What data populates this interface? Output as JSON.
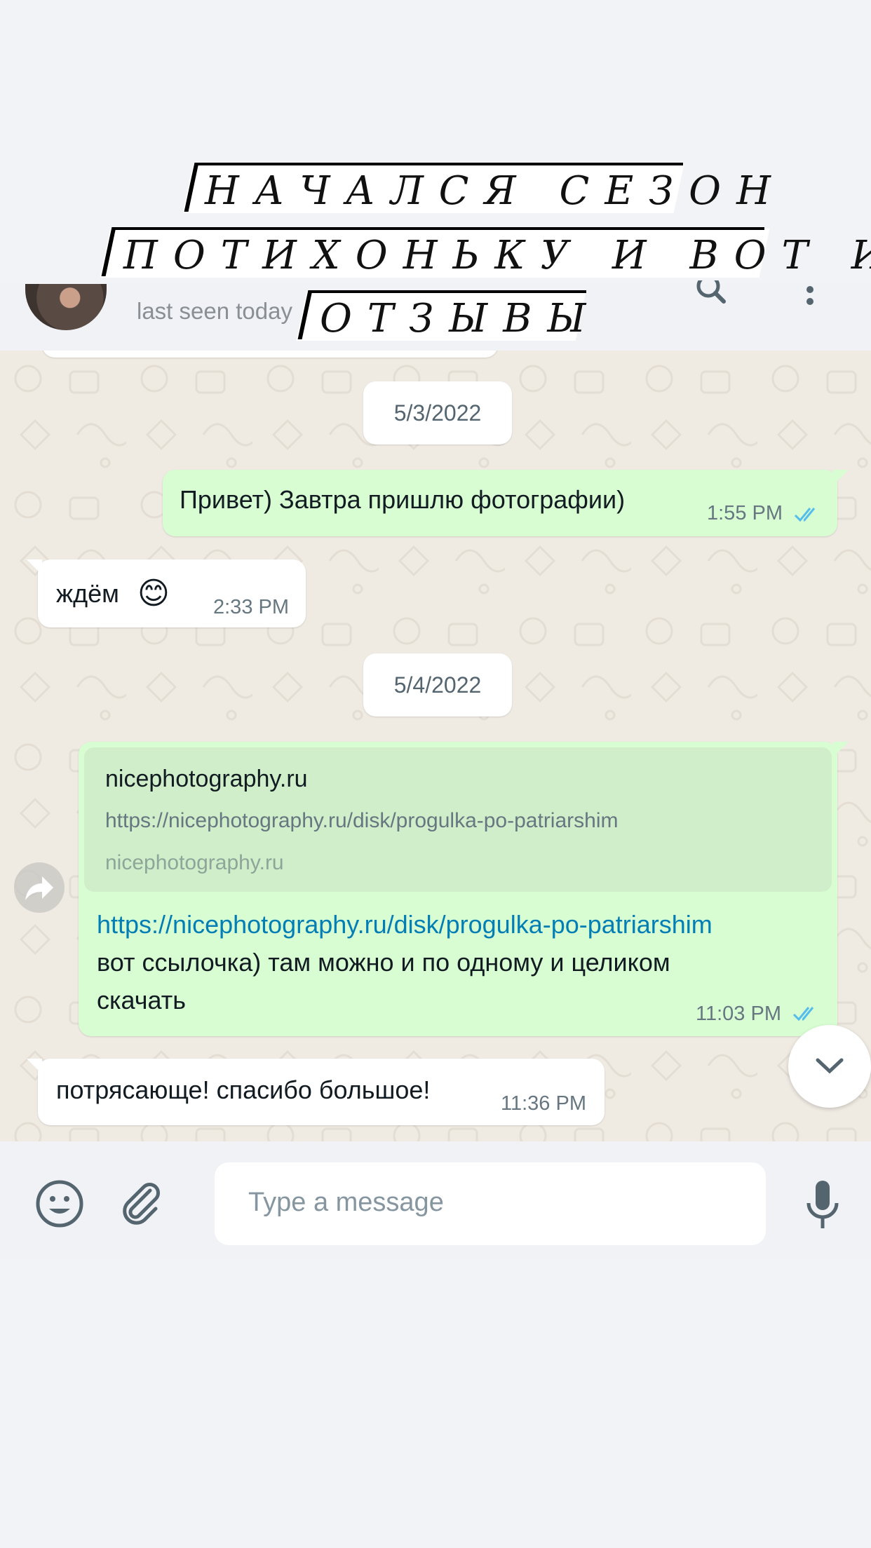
{
  "overlay": {
    "lines": [
      "НАЧАЛСЯ СЕЗОН",
      "ПОТИХОНЬКУ И ВОТ И",
      "ОТЗЫВЫ"
    ]
  },
  "header": {
    "last_seen": "last seen today",
    "icons": [
      "search-icon",
      "menu-icon"
    ]
  },
  "chat": {
    "dates": [
      "5/3/2022",
      "5/4/2022"
    ],
    "messages": [
      {
        "direction": "out",
        "text": "Привет) Завтра пришлю фотографии)",
        "time": "1:55 PM",
        "status": "read"
      },
      {
        "direction": "in",
        "text": "ждём",
        "emoji": "😊",
        "time": "2:33 PM"
      },
      {
        "direction": "out",
        "preview": {
          "title": "nicephotography.ru",
          "url": "https://nicephotography.ru/disk/progulka-po-patriarshim",
          "domain": "nicephotography.ru"
        },
        "link": "https://nicephotography.ru/disk/progulka-po-patriarshim",
        "line1": "вот ссылочка) там можно и по одному и целиком",
        "line2": "скачать",
        "time": "11:03 PM",
        "status": "read"
      },
      {
        "direction": "in",
        "text": "потрясающе! спасибо большое!",
        "time": "11:36 PM"
      }
    ]
  },
  "footer": {
    "placeholder": "Type a message",
    "icons": [
      "emoji-icon",
      "attach-icon",
      "microphone-icon"
    ]
  },
  "colors": {
    "outgoing": "#d9fdd3",
    "incoming": "#ffffff",
    "read_ticks": "#53bdeb",
    "link": "#027eb5"
  }
}
